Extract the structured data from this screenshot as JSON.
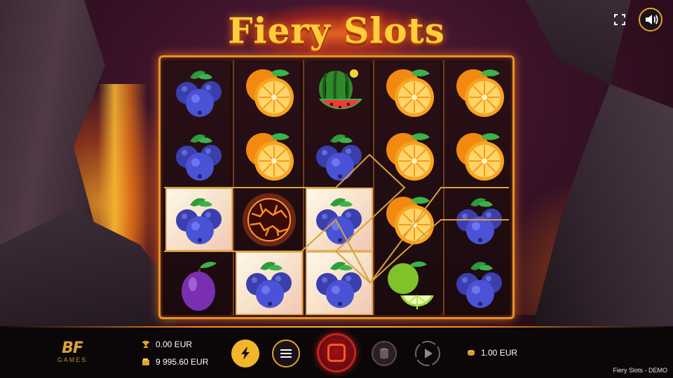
{
  "game": {
    "title": "Fiery Slots",
    "footer_tag": "Fiery Slots - DEMO"
  },
  "brand": {
    "logo_mark": "BF",
    "logo_sub": "GAMES"
  },
  "stats": {
    "win": "0.00 EUR",
    "balance": "9 995.60 EUR",
    "bet": "1.00 EUR"
  },
  "controls": {
    "turbo_icon": "lightning-icon",
    "menu_icon": "hamburger-icon",
    "spin_icon": "spin-square-icon",
    "coins_icon": "coin-stack-icon",
    "autoplay_icon": "play-icon",
    "fullscreen_icon": "fullscreen-icon",
    "sound_icon": "speaker-icon"
  },
  "reels": [
    [
      "blueberry",
      "blueberry",
      "blueberry",
      "plum"
    ],
    [
      "orange",
      "orange",
      "fireball",
      "blueberry"
    ],
    [
      "watermelon",
      "blueberry",
      "blueberry",
      "blueberry"
    ],
    [
      "orange",
      "orange",
      "orange",
      "lime"
    ],
    [
      "orange",
      "orange",
      "blueberry",
      "blueberry"
    ]
  ],
  "winning_cells": [
    [
      0,
      2
    ],
    [
      1,
      3
    ],
    [
      2,
      2
    ],
    [
      2,
      3
    ]
  ],
  "colors": {
    "accent": "#e8902a",
    "title": "#ffcf3a",
    "turbo": "#f2b62d",
    "spin": "#a0101a"
  }
}
